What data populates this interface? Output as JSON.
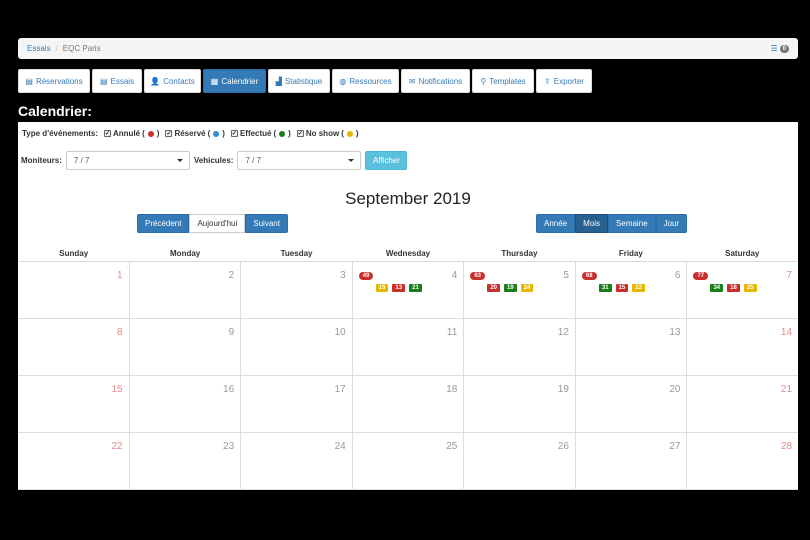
{
  "breadcrumb": {
    "link": "Essais",
    "separator": "/",
    "current": "EQC Paris",
    "badge": "0"
  },
  "tabs": [
    {
      "label": "Réservations",
      "icon": "list-icon",
      "glyph": "▤",
      "active": false,
      "w": 72
    },
    {
      "label": "Essais",
      "icon": "list-icon",
      "glyph": "▤",
      "active": false,
      "w": 50
    },
    {
      "label": "Contacts",
      "icon": "user-icon",
      "glyph": "👤",
      "active": false,
      "w": 57
    },
    {
      "label": "Calendrier",
      "icon": "calendar-icon",
      "glyph": "▦",
      "active": true,
      "w": 63
    },
    {
      "label": "Statistique",
      "icon": "bar-chart-icon",
      "glyph": "▟",
      "active": false,
      "w": 62
    },
    {
      "label": "Ressources",
      "icon": "globe-icon",
      "glyph": "◍",
      "active": false,
      "w": 67
    },
    {
      "label": "Notifications",
      "icon": "envelope-icon",
      "glyph": "✉",
      "active": false,
      "w": 69
    },
    {
      "label": "Templates",
      "icon": "sitemap-icon",
      "glyph": "⚲",
      "active": false,
      "w": 62
    },
    {
      "label": "Exporter",
      "icon": "export-icon",
      "glyph": "⇪",
      "active": false,
      "w": 56
    }
  ],
  "page_title": "Calendrier:",
  "event_types": {
    "label": "Type d'événements:",
    "items": [
      {
        "label": "Annulé",
        "color": "#c9302c"
      },
      {
        "label": "Réservé",
        "color": "#2a8ee0"
      },
      {
        "label": "Effectué",
        "color": "#1a7f1a"
      },
      {
        "label": "No show",
        "color": "#e5b800"
      }
    ]
  },
  "filters": {
    "moniteurs_label": "Moniteurs:",
    "moniteurs_value": "7 / 7",
    "vehicules_label": "Vehicules:",
    "vehicules_value": "7 / 7",
    "submit_label": "Afficher"
  },
  "month_title": "September 2019",
  "nav_buttons": [
    "Précédent",
    "Aujourd'hui",
    "Suivant"
  ],
  "view_buttons": [
    "Année",
    "Mois",
    "Semaine",
    "Jour"
  ],
  "weekdays": [
    "Sunday",
    "Monday",
    "Tuesday",
    "Wednesday",
    "Thursday",
    "Friday",
    "Saturday"
  ],
  "colors": {
    "annule": "#c9302c",
    "effectue": "#1a7f1a",
    "noshow": "#e5b800",
    "primary": "#337ab7"
  },
  "weeks": [
    [
      {
        "num": "1"
      },
      {
        "num": "2"
      },
      {
        "num": "3"
      },
      {
        "num": "4",
        "total": "49",
        "events": [
          {
            "v": "15",
            "t": "noshow"
          },
          {
            "v": "13",
            "t": "annule"
          },
          {
            "v": "21",
            "t": "effectue"
          }
        ]
      },
      {
        "num": "5",
        "total": "63",
        "events": [
          {
            "v": "20",
            "t": "annule"
          },
          {
            "v": "19",
            "t": "effectue"
          },
          {
            "v": "24",
            "t": "noshow"
          }
        ]
      },
      {
        "num": "6",
        "total": "68",
        "events": [
          {
            "v": "31",
            "t": "effectue"
          },
          {
            "v": "15",
            "t": "annule"
          },
          {
            "v": "22",
            "t": "noshow"
          }
        ]
      },
      {
        "num": "7",
        "total": "77",
        "events": [
          {
            "v": "34",
            "t": "effectue"
          },
          {
            "v": "18",
            "t": "annule"
          },
          {
            "v": "25",
            "t": "noshow"
          }
        ]
      }
    ],
    [
      {
        "num": "8"
      },
      {
        "num": "9"
      },
      {
        "num": "10"
      },
      {
        "num": "11"
      },
      {
        "num": "12"
      },
      {
        "num": "13"
      },
      {
        "num": "14"
      }
    ],
    [
      {
        "num": "15"
      },
      {
        "num": "16"
      },
      {
        "num": "17"
      },
      {
        "num": "18"
      },
      {
        "num": "19"
      },
      {
        "num": "20"
      },
      {
        "num": "21"
      }
    ],
    [
      {
        "num": "22"
      },
      {
        "num": "23"
      },
      {
        "num": "24"
      },
      {
        "num": "25"
      },
      {
        "num": "26"
      },
      {
        "num": "27"
      },
      {
        "num": "28"
      }
    ]
  ]
}
